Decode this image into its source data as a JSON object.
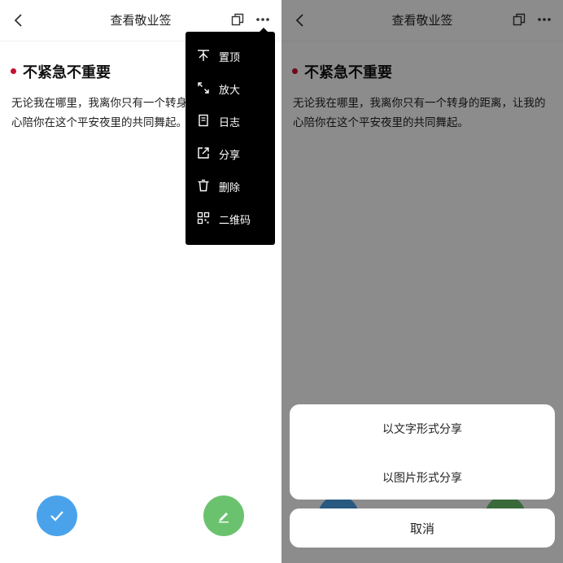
{
  "header": {
    "title": "查看敬业签"
  },
  "note": {
    "title": "不紧急不重要",
    "body": "无论我在哪里，我离你只有一个转身的距离，让我的心陪你在这个平安夜里的共同舞起。",
    "body_truncated": "无论我在哪里，我离你只有一个转身的距离，让我的心陪你在这个平安夜里的共同舞起。",
    "dot_color": "#c8102e"
  },
  "menu": {
    "items": [
      {
        "label": "置顶",
        "icon": "pin-top-icon"
      },
      {
        "label": "放大",
        "icon": "expand-icon"
      },
      {
        "label": "日志",
        "icon": "log-icon"
      },
      {
        "label": "分享",
        "icon": "share-icon"
      },
      {
        "label": "删除",
        "icon": "trash-icon"
      },
      {
        "label": "二维码",
        "icon": "qr-code-icon"
      }
    ]
  },
  "share_sheet": {
    "options": [
      "以文字形式分享",
      "以图片形式分享"
    ],
    "cancel_label": "取消"
  },
  "colors": {
    "done_button": "#4aa3ea",
    "edit_button": "#6bc26e",
    "accent_dot": "#c8102e"
  }
}
